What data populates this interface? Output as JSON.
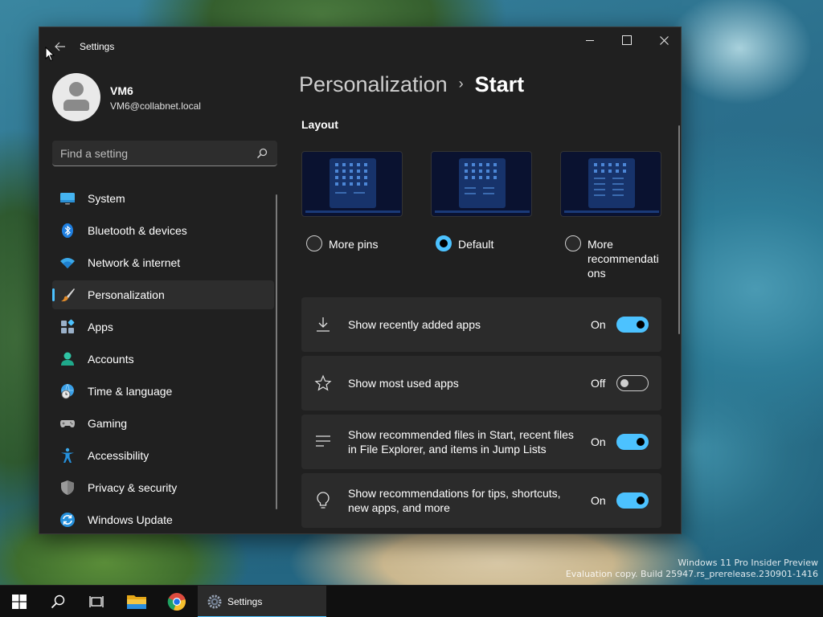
{
  "window": {
    "title": "Settings"
  },
  "profile": {
    "name": "VM6",
    "email": "VM6@collabnet.local"
  },
  "search": {
    "placeholder": "Find a setting"
  },
  "nav": [
    {
      "label": "System",
      "icon": "monitor-icon"
    },
    {
      "label": "Bluetooth & devices",
      "icon": "bluetooth-icon"
    },
    {
      "label": "Network & internet",
      "icon": "wifi-icon"
    },
    {
      "label": "Personalization",
      "icon": "paintbrush-icon",
      "selected": true
    },
    {
      "label": "Apps",
      "icon": "apps-icon"
    },
    {
      "label": "Accounts",
      "icon": "person-icon"
    },
    {
      "label": "Time & language",
      "icon": "globe-clock-icon"
    },
    {
      "label": "Gaming",
      "icon": "gamepad-icon"
    },
    {
      "label": "Accessibility",
      "icon": "accessibility-icon"
    },
    {
      "label": "Privacy & security",
      "icon": "shield-icon"
    },
    {
      "label": "Windows Update",
      "icon": "refresh-icon"
    }
  ],
  "breadcrumb": {
    "parent": "Personalization",
    "separator": "›",
    "current": "Start"
  },
  "layout": {
    "title": "Layout",
    "options": [
      {
        "label": "More pins",
        "checked": false
      },
      {
        "label": "Default",
        "checked": true
      },
      {
        "label": "More recommendati ons",
        "checked": false
      }
    ]
  },
  "settings": [
    {
      "label": "Show recently added apps",
      "state": "On",
      "on": true,
      "icon": "download-icon"
    },
    {
      "label": "Show most used apps",
      "state": "Off",
      "on": false,
      "icon": "star-icon"
    },
    {
      "label": "Show recommended files in Start, recent files in File Explorer, and items in Jump Lists",
      "state": "On",
      "on": true,
      "icon": "list-icon"
    },
    {
      "label": "Show recommendations for tips, shortcuts, new apps, and more",
      "state": "On",
      "on": true,
      "icon": "lightbulb-icon"
    }
  ],
  "taskbar": {
    "apps": [
      {
        "name": "start-icon"
      },
      {
        "name": "search-icon"
      },
      {
        "name": "task-view-icon"
      },
      {
        "name": "file-explorer-icon"
      },
      {
        "name": "chrome-icon"
      }
    ],
    "active_app": "Settings"
  },
  "watermark": {
    "line1": "Windows 11 Pro Insider Preview",
    "line2": "Evaluation copy. Build 25947.rs_prerelease.230901-1416"
  },
  "colors": {
    "accent": "#4cc2ff",
    "window_bg": "#202020",
    "card_bg": "#2b2b2b"
  }
}
